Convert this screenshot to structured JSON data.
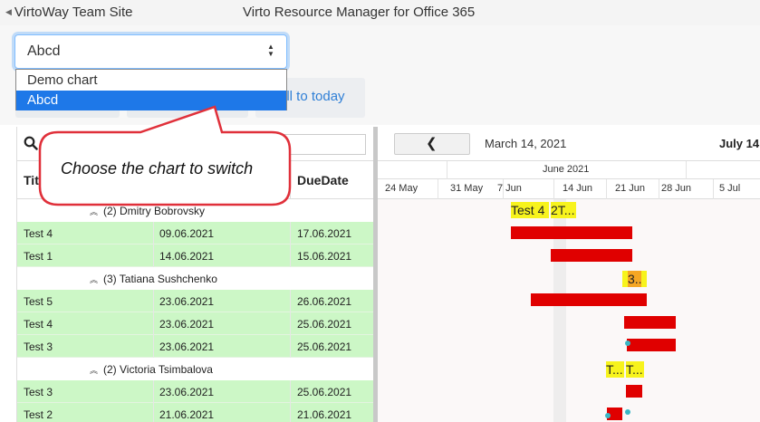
{
  "header": {
    "site_link": "VirtoWay Team Site",
    "app_title": "Virto Resource Manager for Office 365"
  },
  "chart_select": {
    "value": "Abcd",
    "options": [
      "Demo chart",
      "Abcd"
    ],
    "selected_index": 1
  },
  "toolbar": {
    "scroll_to_today_partial": "oll to today"
  },
  "callout": {
    "text": "Choose the chart to switch"
  },
  "grid": {
    "columns": [
      "Titl",
      "",
      "DueDate"
    ],
    "rows": [
      {
        "type": "group",
        "label": "(2) Dmitry Bobrovsky"
      },
      {
        "type": "task",
        "title": "Test 4",
        "start": "09.06.2021",
        "due": "17.06.2021"
      },
      {
        "type": "task",
        "title": "Test 1",
        "start": "14.06.2021",
        "due": "15.06.2021"
      },
      {
        "type": "group",
        "label": "(3) Tatiana Sushchenko"
      },
      {
        "type": "task",
        "title": "Test 5",
        "start": "23.06.2021",
        "due": "26.06.2021"
      },
      {
        "type": "task",
        "title": "Test 4",
        "start": "23.06.2021",
        "due": "25.06.2021"
      },
      {
        "type": "task",
        "title": "Test 3",
        "start": "23.06.2021",
        "due": "25.06.2021"
      },
      {
        "type": "group",
        "label": "(2) Victoria Tsimbalova"
      },
      {
        "type": "task",
        "title": "Test 3",
        "start": "23.06.2021",
        "due": "25.06.2021"
      },
      {
        "type": "task",
        "title": "Test 2",
        "start": "21.06.2021",
        "due": "21.06.2021"
      }
    ]
  },
  "gantt": {
    "current_date": "March 14, 2021",
    "next_date": "July 14",
    "month": "June 2021",
    "weeks": [
      "24 May",
      "31 May",
      "7 Jun",
      "14 Jun",
      "21 Jun",
      "28 Jun",
      "5 Jul"
    ],
    "labels": {
      "row0_a": "Test 4",
      "row0_b": "2T...",
      "row3_a": "3..",
      "row7_a": "T...",
      "row7_b": "T..."
    }
  },
  "colors": {
    "accent": "#1e78e8",
    "task_row": "#ccf7c6",
    "bar": "#e00000",
    "label": "#f7f31d",
    "callout_border": "#e0303a"
  }
}
